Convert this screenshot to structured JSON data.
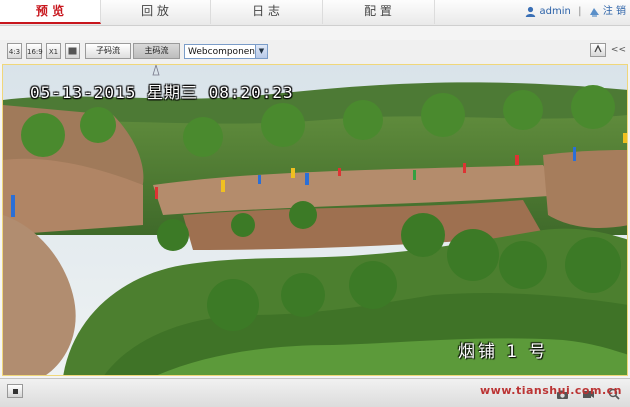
{
  "nav": {
    "tabs": [
      {
        "label": "预 览",
        "active": true
      },
      {
        "label": "回 放",
        "active": false
      },
      {
        "label": "日 志",
        "active": false
      },
      {
        "label": "配 置",
        "active": false
      }
    ],
    "user_icon": "user-icon",
    "username": "admin",
    "separator": "|",
    "logout_icon": "logout-icon",
    "logout_label": "注 销"
  },
  "toolbar": {
    "size_buttons": [
      "4:3",
      "16:9",
      "X1",
      "auto"
    ],
    "sub_stream_label": "子码流",
    "main_stream_label": "主码流",
    "plugin_select": "Webcomponents",
    "right_tools": [
      "fullscreen-icon",
      "collapse-icon"
    ],
    "collapse_label": "<<"
  },
  "video": {
    "osd_datetime": "05-13-2015 星期三 08:20:23",
    "osd_channel": "烟铺 1 号"
  },
  "bottom": {
    "stop_icon": "stop-icon",
    "right_icons": [
      "capture-icon",
      "record-icon",
      "zoom-icon"
    ]
  },
  "watermark": "www.tianshui.com.cn",
  "colors": {
    "active_tab": "#c8161d",
    "user_link": "#2c62a8"
  }
}
